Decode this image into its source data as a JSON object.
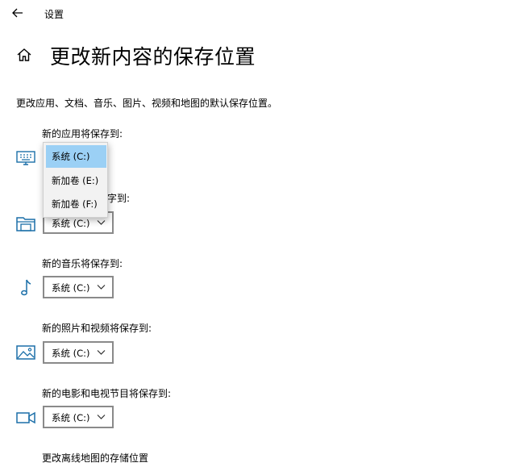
{
  "window": {
    "title": "设置"
  },
  "header": {
    "title": "更改新内容的保存位置"
  },
  "description": "更改应用、文档、音乐、图片、视频和地图的默认保存位置。",
  "sections": {
    "apps": {
      "label": "新的应用将保存到:",
      "icon": "monitor-icon"
    },
    "documents": {
      "label_visible_suffix": "字到:",
      "value": "系统 (C:)",
      "icon": "folder-icon"
    },
    "music": {
      "label": "新的音乐将保存到:",
      "value": "系统 (C:)",
      "icon": "music-note-icon"
    },
    "photos": {
      "label": "新的照片和视频将保存到:",
      "value": "系统 (C:)",
      "icon": "picture-icon"
    },
    "movies": {
      "label": "新的电影和电视节目将保存到:",
      "value": "系统 (C:)",
      "icon": "video-camera-icon"
    }
  },
  "dropdown_open": {
    "options": [
      "系统 (C:)",
      "新加卷 (E:)",
      "新加卷 (F:)"
    ],
    "selected": "系统 (C:)"
  },
  "offline_maps_link": "更改离线地图的存储位置",
  "colors": {
    "accent": "#1b6fa8",
    "selection": "#9bd0f5",
    "border": "#8a8a8a"
  }
}
